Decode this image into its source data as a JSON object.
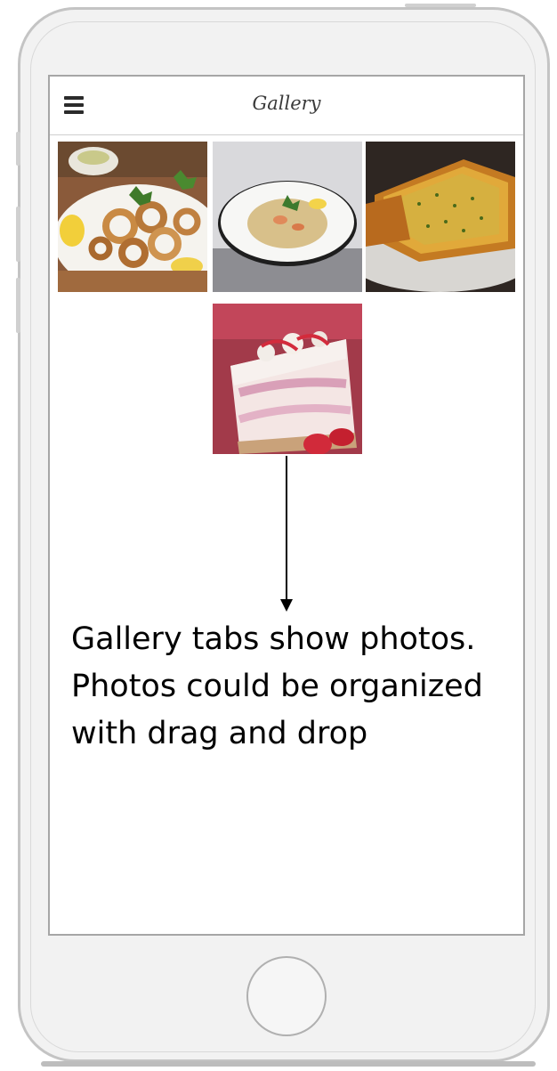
{
  "header": {
    "title": "Gallery",
    "menu_icon": "hamburger-menu-icon"
  },
  "gallery": {
    "photos": [
      {
        "name": "fried-calamari-photo"
      },
      {
        "name": "risotto-photo"
      },
      {
        "name": "garlic-bread-photo"
      },
      {
        "name": "strawberry-cheesecake-photo"
      }
    ]
  },
  "annotation": {
    "text": "Gallery tabs show photos. Photos could be organized with drag and drop"
  },
  "colors": {
    "screen_border": "#a6a6a6",
    "phone_body": "#f2f2f2",
    "text": "#000000"
  }
}
